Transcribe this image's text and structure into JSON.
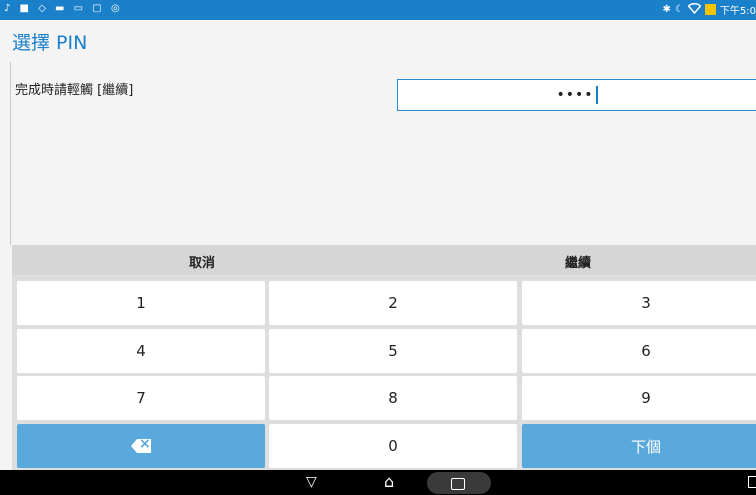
{
  "status_bar": {
    "left_icons": "♪ ■ ◇ ▬ ▭ ▢ ◎",
    "bluetooth": "✱",
    "moon": "☾",
    "time": "下午5:0"
  },
  "title": "選擇 PIN",
  "prompt": "完成時請輕觸 [繼續]",
  "pin": {
    "masked_value": "••••"
  },
  "actions": {
    "cancel": "取消",
    "continue": "繼續"
  },
  "keypad": {
    "keys": [
      "1",
      "2",
      "3",
      "4",
      "5",
      "6",
      "7",
      "8",
      "9"
    ],
    "zero": "0",
    "next": "下個",
    "delete_icon": "backspace-icon"
  },
  "nav": {
    "back": "▽",
    "home": "⌂"
  },
  "colors": {
    "accent": "#1a80c9",
    "key_blue": "#5aa9dc",
    "background": "#f4f4f4"
  }
}
